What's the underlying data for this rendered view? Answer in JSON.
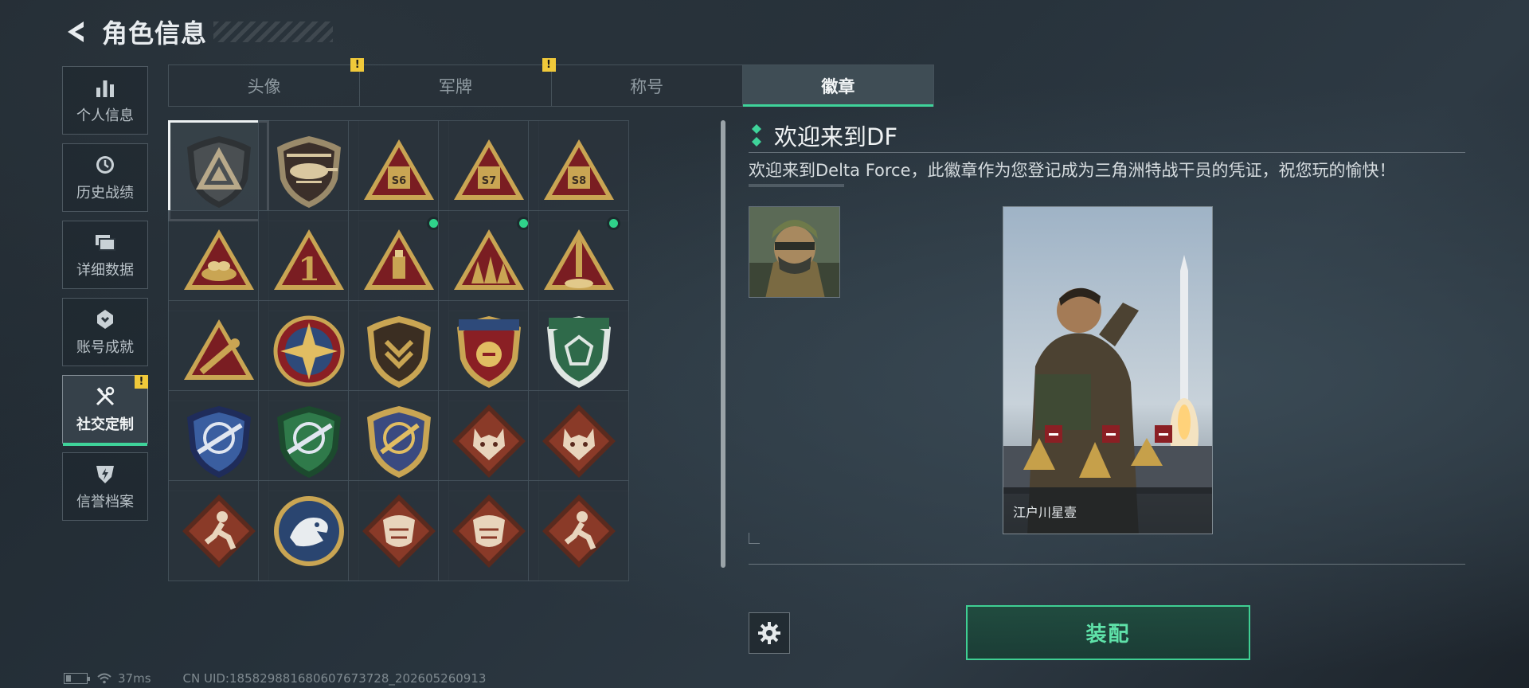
{
  "header": {
    "title": "角色信息"
  },
  "sidebar": {
    "items": [
      {
        "label": "个人信息",
        "icon": "bar-chart-icon"
      },
      {
        "label": "历史战绩",
        "icon": "clock-icon"
      },
      {
        "label": "详细数据",
        "icon": "folder-icon"
      },
      {
        "label": "账号成就",
        "icon": "achievement-icon"
      },
      {
        "label": "社交定制",
        "icon": "wrench-screwdriver-icon",
        "badge": "!"
      },
      {
        "label": "信誉档案",
        "icon": "shield-lightning-icon"
      }
    ],
    "active_index": 4
  },
  "tabs": [
    {
      "label": "头像",
      "badge": "!"
    },
    {
      "label": "军牌",
      "badge": "!"
    },
    {
      "label": "称号"
    },
    {
      "label": "徽章"
    }
  ],
  "badges": [
    {
      "id": "triangle-emblem",
      "selected": true,
      "new": false,
      "label": ""
    },
    {
      "id": "helicopter",
      "new": false,
      "label": ""
    },
    {
      "id": "s6",
      "new": false,
      "label": "S6"
    },
    {
      "id": "s7",
      "new": false,
      "label": "S7"
    },
    {
      "id": "s8",
      "new": false,
      "label": "S8"
    },
    {
      "id": "bird-nest",
      "new": false,
      "label": ""
    },
    {
      "id": "number-one",
      "new": false,
      "label": "1"
    },
    {
      "id": "usb-drive",
      "new": true,
      "label": ""
    },
    {
      "id": "soldiers",
      "new": true,
      "label": ""
    },
    {
      "id": "rocket",
      "new": true,
      "label": ""
    },
    {
      "id": "hand-drill",
      "new": false,
      "label": ""
    },
    {
      "id": "compass-star",
      "new": false,
      "label": ""
    },
    {
      "id": "shield-chevron",
      "new": false,
      "label": ""
    },
    {
      "id": "laurel-stars",
      "new": false,
      "label": ""
    },
    {
      "id": "green-gem",
      "new": false,
      "label": ""
    },
    {
      "id": "blue-rifle",
      "new": false,
      "label": ""
    },
    {
      "id": "green-rifle",
      "new": false,
      "label": ""
    },
    {
      "id": "gold-knife",
      "new": false,
      "label": ""
    },
    {
      "id": "wolf-1",
      "new": false,
      "label": ""
    },
    {
      "id": "wolf-2",
      "new": false,
      "label": ""
    },
    {
      "id": "runner",
      "new": false,
      "label": ""
    },
    {
      "id": "eagle",
      "new": false,
      "label": ""
    },
    {
      "id": "dragon-1",
      "new": false,
      "label": ""
    },
    {
      "id": "dragon-2",
      "new": false,
      "label": ""
    },
    {
      "id": "sprinter",
      "new": false,
      "label": ""
    }
  ],
  "detail": {
    "name": "欢迎来到DF",
    "description": "欢迎来到Delta Force，此徽章作为您登记成为三角洲特战干员的凭证，祝您玩的愉快！",
    "preview_caption": "江户川星壹"
  },
  "actions": {
    "equip_label": "装配"
  },
  "footer": {
    "ping": "37ms",
    "uid": "CN UID:18582988168060767372​8_202605260913"
  },
  "colors": {
    "accent": "#3fd39a",
    "warning": "#f0c93a",
    "background": "#26313a"
  }
}
